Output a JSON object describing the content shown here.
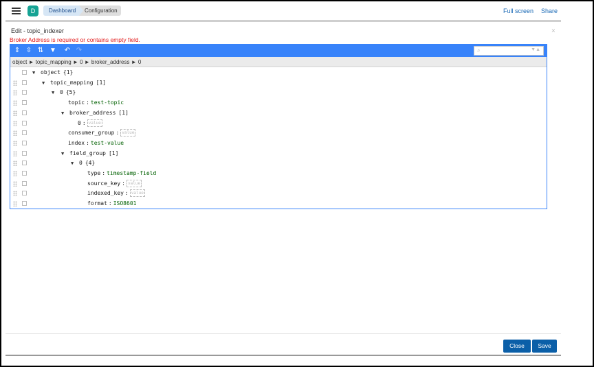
{
  "header": {
    "app_badge": "D",
    "breadcrumbs": [
      "Dashboard",
      "Configuration"
    ],
    "full_screen": "Full screen",
    "share": "Share"
  },
  "dialog": {
    "title": "Edit - topic_indexer",
    "close": "×",
    "error": "Broker Address is required or contains empty field."
  },
  "editor": {
    "menu_icons": [
      "expand-all-icon",
      "collapse-all-icon",
      "sort-icon",
      "filter-icon",
      "undo-icon",
      "redo-icon"
    ],
    "search_placeholder": "",
    "navigation": "object ► topic_mapping ► 0 ► broker_address ► 0",
    "rows": [
      {
        "key": "object",
        "type": "object",
        "count": "{1}",
        "level": 0
      },
      {
        "key": "topic_mapping",
        "type": "array",
        "count": "[1]",
        "level": 1
      },
      {
        "key": "0",
        "type": "object",
        "count": "{5}",
        "level": 2
      },
      {
        "key": "topic",
        "type": "value",
        "value": "test-topic",
        "level": 3
      },
      {
        "key": "broker_address",
        "type": "array",
        "count": "[1]",
        "level": 3
      },
      {
        "key": "0",
        "type": "emptyvalue",
        "value": "value",
        "level": 4
      },
      {
        "key": "consumer_group",
        "type": "emptyvalue",
        "value": "value",
        "level": 3
      },
      {
        "key": "index",
        "type": "value",
        "value": "test-value",
        "level": 3
      },
      {
        "key": "field_group",
        "type": "array",
        "count": "[1]",
        "level": 3
      },
      {
        "key": "0",
        "type": "object",
        "count": "{4}",
        "level": 4
      },
      {
        "key": "type",
        "type": "value",
        "value": "timestamp-field",
        "level": 5
      },
      {
        "key": "source_key",
        "type": "emptyvalue",
        "value": "value",
        "level": 5
      },
      {
        "key": "indexed_key",
        "type": "emptyvalue",
        "value": "value",
        "level": 5
      },
      {
        "key": "format",
        "type": "value",
        "value": "ISO8601",
        "level": 5
      }
    ]
  },
  "footer": {
    "close": "Close",
    "save": "Save"
  },
  "colors": {
    "accent": "#3883fa",
    "button": "#0b5fa8",
    "error": "#e21b1b",
    "value": "#006000"
  }
}
